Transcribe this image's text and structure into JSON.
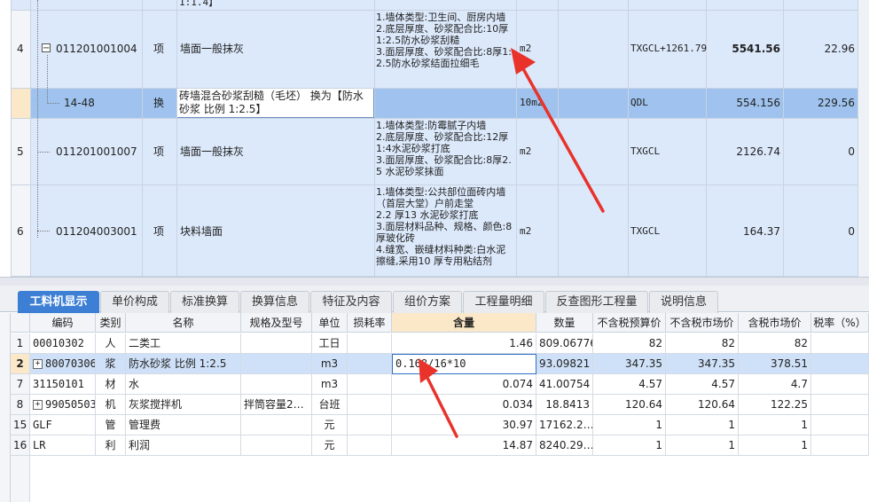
{
  "upper_rows": [
    {
      "idx": "",
      "code": "",
      "type": "",
      "name": "",
      "desc": "1:1.4】",
      "unit": "",
      "qty": "",
      "expr": "",
      "amount": "",
      "price": ""
    },
    {
      "idx": "4",
      "code": "011201001004",
      "type": "项",
      "name": "墙面一般抹灰",
      "desc": "1.墙体类型:卫生间、厨房内墙\n2.底层厚度、砂浆配合比:10厚1:2.5防水砂浆刮糙\n3.面层厚度、砂浆配合比:8厚1:2.5防水砂浆结面拉细毛",
      "unit": "m2",
      "qty": "",
      "expr": "TXGCL+1261.79",
      "amount": "5541.56",
      "price": "22.96"
    },
    {
      "idx": "",
      "code": "14-48",
      "type": "换",
      "name": "砖墙混合砂浆刮糙（毛坯） 换为【防水砂浆 比例 1:2.5】",
      "desc": "",
      "unit": "10m2",
      "qty": "",
      "expr": "QDL",
      "amount": "554.156",
      "price": "229.56"
    },
    {
      "idx": "5",
      "code": "011201001007",
      "type": "项",
      "name": "墙面一般抹灰",
      "desc": "1.墙体类型:防霉腻子内墙\n2.底层厚度、砂浆配合比:12厚1:4水泥砂浆打底\n3.面层厚度、砂浆配合比:8厚2.5 水泥砂浆抹面",
      "unit": "m2",
      "qty": "",
      "expr": "TXGCL",
      "amount": "2126.74",
      "price": "0"
    },
    {
      "idx": "6",
      "code": "011204003001",
      "type": "项",
      "name": "块料墙面",
      "desc": "1.墙体类型:公共部位面砖内墙（首层大堂）户前走堂\n2.2 厚13 水泥砂浆打底\n3.面层材料品种、规格、颜色:8 厚玻化砖\n4.缝宽、嵌缝材料种类:白水泥擦缝,采用10 厚专用粘结剂",
      "unit": "m2",
      "qty": "",
      "expr": "TXGCL",
      "amount": "164.37",
      "price": "0"
    }
  ],
  "tabs": [
    "工料机显示",
    "单价构成",
    "标准换算",
    "换算信息",
    "特征及内容",
    "组价方案",
    "工程量明细",
    "反查图形工程量",
    "说明信息"
  ],
  "columns": [
    "编码",
    "类别",
    "名称",
    "规格及型号",
    "单位",
    "损耗率",
    "含量",
    "数量",
    "不含税预算价",
    "不含税市场价",
    "含税市场价",
    "税率（%）"
  ],
  "lower_rows": [
    {
      "no": "1",
      "code": "00010302",
      "cat": "人",
      "name": "二类工",
      "spec": "",
      "unit": "工日",
      "loss": "",
      "content": "1.46",
      "qty": "809.06776",
      "p1": "82",
      "p2": "82",
      "p3": "82"
    },
    {
      "no": "2",
      "code": "80070306",
      "cat": "浆",
      "name": "防水砂浆 比例 1:2.5",
      "spec": "",
      "unit": "m3",
      "loss": "",
      "content": "0.168/16*10",
      "qty": "93.09821",
      "p1": "347.35",
      "p2": "347.35",
      "p3": "378.51"
    },
    {
      "no": "7",
      "code": "31150101",
      "cat": "材",
      "name": "水",
      "spec": "",
      "unit": "m3",
      "loss": "",
      "content": "0.074",
      "qty": "41.00754",
      "p1": "4.57",
      "p2": "4.57",
      "p3": "4.7"
    },
    {
      "no": "8",
      "code": "99050503",
      "cat": "机",
      "name": "灰浆搅拌机",
      "spec": "拌筒容量2…",
      "unit": "台班",
      "loss": "",
      "content": "0.034",
      "qty": "18.8413",
      "p1": "120.64",
      "p2": "120.64",
      "p3": "122.25"
    },
    {
      "no": "15",
      "code": "GLF",
      "cat": "管",
      "name": "管理费",
      "spec": "",
      "unit": "元",
      "loss": "",
      "content": "30.97",
      "qty": "17162.2…",
      "p1": "1",
      "p2": "1",
      "p3": "1"
    },
    {
      "no": "16",
      "code": "LR",
      "cat": "利",
      "name": "利润",
      "spec": "",
      "unit": "元",
      "loss": "",
      "content": "14.87",
      "qty": "8240.29…",
      "p1": "1",
      "p2": "1",
      "p3": "1"
    }
  ],
  "colors": {
    "row_blue": "#dce9fb",
    "row_selected": "#9fc3ee",
    "tab_active": "#3d7fd4",
    "header_highlight": "#fbe8c8",
    "arrow": "#e8322a"
  }
}
